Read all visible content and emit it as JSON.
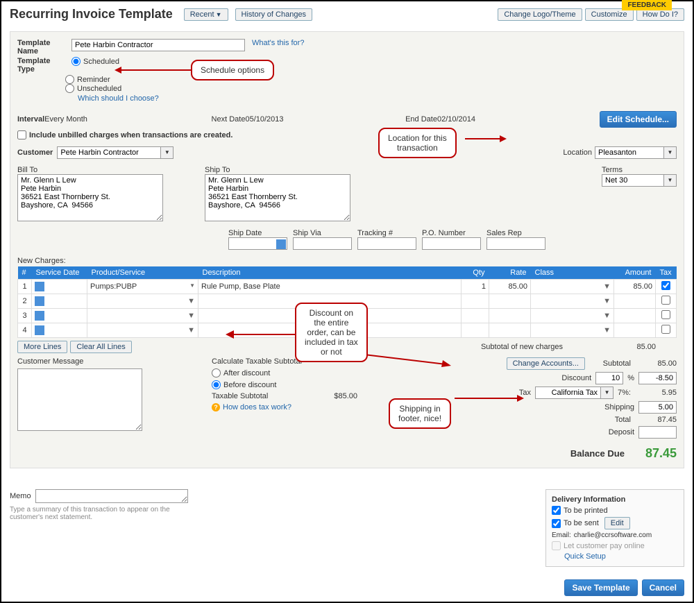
{
  "header": {
    "title": "Recurring Invoice Template",
    "recent_btn": "Recent",
    "history_btn": "History of Changes",
    "change_logo_btn": "Change Logo/Theme",
    "customize_btn": "Customize",
    "howdoi_btn": "How Do I?",
    "feedback": "FEEDBACK"
  },
  "template": {
    "name_label": "Template Name",
    "name_value": "Pete Harbin Contractor",
    "whats_this": "What's this for?",
    "type_label": "Template Type",
    "scheduled": "Scheduled",
    "reminder": "Reminder",
    "unscheduled": "Unscheduled",
    "which_link": "Which should I choose?"
  },
  "schedule": {
    "interval_label": "Interval",
    "interval_value": "Every Month",
    "next_label": "Next Date",
    "next_value": "05/10/2013",
    "end_label": "End Date",
    "end_value": "02/10/2014",
    "edit_btn": "Edit Schedule...",
    "include_unbilled": "Include unbilled charges when transactions are created."
  },
  "customer": {
    "label": "Customer",
    "value": "Pete Harbin Contractor",
    "location_label": "Location",
    "location_value": "Pleasanton"
  },
  "address": {
    "billto_label": "Bill To",
    "billto": "Mr. Glenn L Lew\nPete Harbin\n36521 East Thornberry St.\nBayshore, CA  94566",
    "shipto_label": "Ship To",
    "shipto": "Mr. Glenn L Lew\nPete Harbin\n36521 East Thornberry St.\nBayshore, CA  94566",
    "terms_label": "Terms",
    "terms_value": "Net 30"
  },
  "shipfields": {
    "ship_date": "Ship Date",
    "ship_via": "Ship Via",
    "tracking": "Tracking #",
    "po": "P.O. Number",
    "sales_rep": "Sales Rep"
  },
  "charges": {
    "header": "New Charges:",
    "cols": {
      "num": "#",
      "date": "Service Date",
      "product": "Product/Service",
      "desc": "Description",
      "qty": "Qty",
      "rate": "Rate",
      "class": "Class",
      "amount": "Amount",
      "tax": "Tax"
    },
    "rows": [
      {
        "n": "1",
        "product": "Pumps:PUBP",
        "desc": "Rule Pump, Base Plate",
        "qty": "1",
        "rate": "85.00",
        "amount": "85.00",
        "tax": true
      },
      {
        "n": "2"
      },
      {
        "n": "3"
      },
      {
        "n": "4"
      }
    ],
    "more_lines": "More Lines",
    "clear_lines": "Clear All Lines",
    "subtotal_new_label": "Subtotal of new charges",
    "subtotal_new_value": "85.00"
  },
  "totals": {
    "change_accounts": "Change Accounts...",
    "subtotal_label": "Subtotal",
    "subtotal_value": "85.00",
    "discount_label": "Discount",
    "discount_pct": "10",
    "discount_value": "-8.50",
    "tax_label": "Tax",
    "tax_select": "California Tax",
    "tax_pct": "7%:",
    "tax_value": "5.95",
    "shipping_label": "Shipping",
    "shipping_value": "5.00",
    "total_label": "Total",
    "total_value": "87.45",
    "deposit_label": "Deposit",
    "deposit_value": "",
    "balance_due_label": "Balance Due",
    "balance_due_value": "87.45"
  },
  "custmsg": {
    "label": "Customer Message"
  },
  "taxsub": {
    "label": "Calculate Taxable Subtotal",
    "after": "After discount",
    "before": "Before discount",
    "taxable_subtotal_label": "Taxable Subtotal",
    "taxable_subtotal_value": "$85.00",
    "how_link": "How does tax work?"
  },
  "memo": {
    "label": "Memo",
    "hint": "Type a summary of this transaction to appear on the customer's next statement."
  },
  "delivery": {
    "header": "Delivery Information",
    "printed": "To be printed",
    "sent": "To be sent",
    "edit": "Edit",
    "email_label": "Email:",
    "email_value": "charlie@ccrsoftware.com",
    "pay_online": "Let customer pay online",
    "quick_setup": "Quick Setup"
  },
  "footer_btns": {
    "save": "Save Template",
    "cancel": "Cancel"
  },
  "annotations": {
    "schedule_opts": "Schedule options",
    "location": "Location for this\ntransaction",
    "discount": "Discount on\nthe entire\norder, can be\nincluded in tax\nor not",
    "shipping": "Shipping in\nfooter, nice!"
  }
}
